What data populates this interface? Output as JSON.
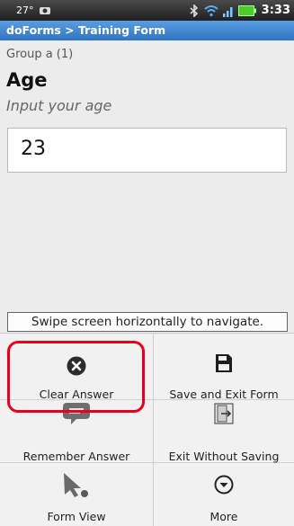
{
  "status_bar": {
    "temperature": "27°",
    "time": "3:33"
  },
  "title_bar": {
    "title": "doForms > Training Form"
  },
  "form": {
    "group_label": "Group a (1)",
    "question": "Age",
    "hint": "Input your age",
    "answer_value": "23"
  },
  "swipe_hint": "Swipe screen horizontally to navigate.",
  "menu": {
    "clear_answer": {
      "label": "Clear Answer",
      "icon": "x-circle-icon"
    },
    "save_exit": {
      "label": "Save and Exit Form",
      "icon": "floppy-disk-icon"
    },
    "remember_answer": {
      "label": "Remember Answer",
      "icon": "speech-bubble-icon"
    },
    "exit_without_saving": {
      "label": "Exit Without Saving",
      "icon": "exit-door-icon"
    },
    "form_view": {
      "label": "Form View",
      "icon": "form-view-icon"
    },
    "more": {
      "label": "More",
      "icon": "chevron-down-circle-icon"
    }
  },
  "colors": {
    "title_bar": "#3d86d6",
    "highlight": "#e8001c"
  }
}
